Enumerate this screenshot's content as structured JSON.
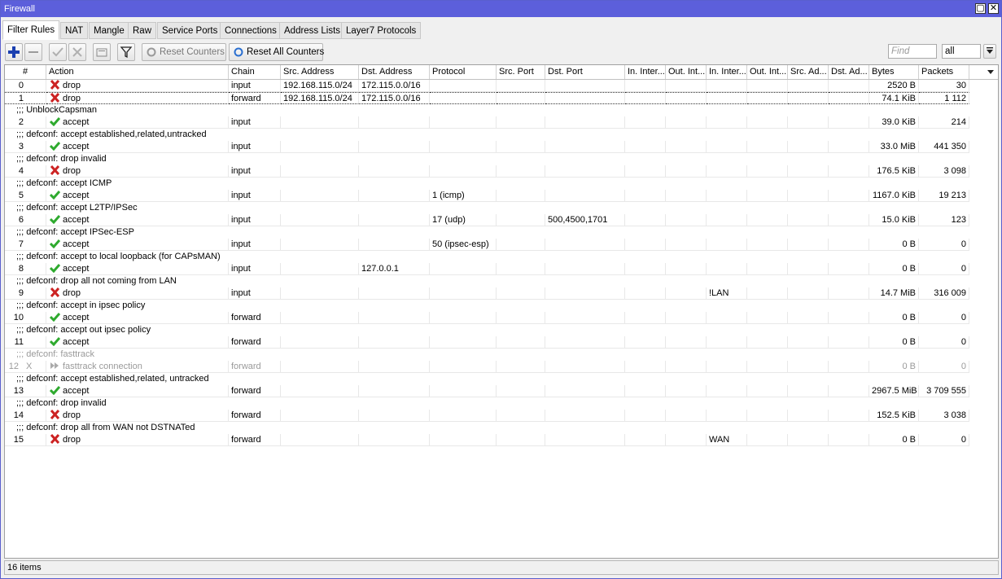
{
  "window": {
    "title": "Firewall"
  },
  "tabs": [
    "Filter Rules",
    "NAT",
    "Mangle",
    "Raw",
    "Service Ports",
    "Connections",
    "Address Lists",
    "Layer7 Protocols"
  ],
  "toolbar": {
    "reset_counters": "Reset Counters",
    "reset_all_counters": "Reset All Counters",
    "find_placeholder": "Find",
    "filter_value": "all"
  },
  "columns": [
    "#",
    "Action",
    "Chain",
    "Src. Address",
    "Dst. Address",
    "Protocol",
    "Src. Port",
    "Dst. Port",
    "In. Inter...",
    "Out. Int...",
    "In. Inter...",
    "Out. Int...",
    "Src. Ad...",
    "Dst. Ad...",
    "Bytes",
    "Packets"
  ],
  "rows": [
    {
      "type": "rule",
      "num": "0",
      "flag": "",
      "action": "drop",
      "icon": "drop",
      "chain": "input",
      "src": "192.168.115.0/24",
      "dst": "172.115.0.0/16",
      "proto": "",
      "sport": "",
      "dport": "",
      "inil": "",
      "bytes": "2520 B",
      "packets": "30"
    },
    {
      "type": "rule",
      "num": "1",
      "flag": "",
      "action": "drop",
      "icon": "drop",
      "chain": "forward",
      "src": "192.168.115.0/24",
      "dst": "172.115.0.0/16",
      "proto": "",
      "sport": "",
      "dport": "",
      "inil": "",
      "bytes": "74.1 KiB",
      "packets": "1 112",
      "selected": true
    },
    {
      "type": "comment",
      "text": ";;; UnblockCapsman"
    },
    {
      "type": "rule",
      "num": "2",
      "flag": "",
      "action": "accept",
      "icon": "accept",
      "chain": "input",
      "src": "",
      "dst": "",
      "proto": "",
      "sport": "",
      "dport": "",
      "inil": "",
      "bytes": "39.0 KiB",
      "packets": "214"
    },
    {
      "type": "comment",
      "text": ";;; defconf: accept established,related,untracked"
    },
    {
      "type": "rule",
      "num": "3",
      "flag": "",
      "action": "accept",
      "icon": "accept",
      "chain": "input",
      "src": "",
      "dst": "",
      "proto": "",
      "sport": "",
      "dport": "",
      "inil": "",
      "bytes": "33.0 MiB",
      "packets": "441 350"
    },
    {
      "type": "comment",
      "text": ";;; defconf: drop invalid"
    },
    {
      "type": "rule",
      "num": "4",
      "flag": "",
      "action": "drop",
      "icon": "drop",
      "chain": "input",
      "src": "",
      "dst": "",
      "proto": "",
      "sport": "",
      "dport": "",
      "inil": "",
      "bytes": "176.5 KiB",
      "packets": "3 098"
    },
    {
      "type": "comment",
      "text": ";;; defconf: accept ICMP"
    },
    {
      "type": "rule",
      "num": "5",
      "flag": "",
      "action": "accept",
      "icon": "accept",
      "chain": "input",
      "src": "",
      "dst": "",
      "proto": "1 (icmp)",
      "sport": "",
      "dport": "",
      "inil": "",
      "bytes": "1167.0 KiB",
      "packets": "19 213"
    },
    {
      "type": "comment",
      "text": ";;; defconf: accept L2TP/IPSec"
    },
    {
      "type": "rule",
      "num": "6",
      "flag": "",
      "action": "accept",
      "icon": "accept",
      "chain": "input",
      "src": "",
      "dst": "",
      "proto": "17 (udp)",
      "sport": "",
      "dport": "500,4500,1701",
      "inil": "",
      "bytes": "15.0 KiB",
      "packets": "123"
    },
    {
      "type": "comment",
      "text": ";;; defconf: accept IPSec-ESP"
    },
    {
      "type": "rule",
      "num": "7",
      "flag": "",
      "action": "accept",
      "icon": "accept",
      "chain": "input",
      "src": "",
      "dst": "",
      "proto": "50 (ipsec-esp)",
      "sport": "",
      "dport": "",
      "inil": "",
      "bytes": "0 B",
      "packets": "0"
    },
    {
      "type": "comment",
      "text": ";;; defconf: accept to local loopback (for CAPsMAN)"
    },
    {
      "type": "rule",
      "num": "8",
      "flag": "",
      "action": "accept",
      "icon": "accept",
      "chain": "input",
      "src": "",
      "dst": "127.0.0.1",
      "proto": "",
      "sport": "",
      "dport": "",
      "inil": "",
      "bytes": "0 B",
      "packets": "0"
    },
    {
      "type": "comment",
      "text": ";;; defconf: drop all not coming from LAN"
    },
    {
      "type": "rule",
      "num": "9",
      "flag": "",
      "action": "drop",
      "icon": "drop",
      "chain": "input",
      "src": "",
      "dst": "",
      "proto": "",
      "sport": "",
      "dport": "",
      "inil": "!LAN",
      "bytes": "14.7 MiB",
      "packets": "316 009"
    },
    {
      "type": "comment",
      "text": ";;; defconf: accept in ipsec policy"
    },
    {
      "type": "rule",
      "num": "10",
      "flag": "",
      "action": "accept",
      "icon": "accept",
      "chain": "forward",
      "src": "",
      "dst": "",
      "proto": "",
      "sport": "",
      "dport": "",
      "inil": "",
      "bytes": "0 B",
      "packets": "0"
    },
    {
      "type": "comment",
      "text": ";;; defconf: accept out ipsec policy"
    },
    {
      "type": "rule",
      "num": "11",
      "flag": "",
      "action": "accept",
      "icon": "accept",
      "chain": "forward",
      "src": "",
      "dst": "",
      "proto": "",
      "sport": "",
      "dport": "",
      "inil": "",
      "bytes": "0 B",
      "packets": "0"
    },
    {
      "type": "comment",
      "text": ";;; defconf: fasttrack",
      "disabled": true
    },
    {
      "type": "rule",
      "num": "12",
      "flag": "X",
      "action": "fasttrack connection",
      "icon": "fasttrack",
      "chain": "forward",
      "src": "",
      "dst": "",
      "proto": "",
      "sport": "",
      "dport": "",
      "inil": "",
      "bytes": "0 B",
      "packets": "0",
      "disabled": true
    },
    {
      "type": "comment",
      "text": ";;; defconf: accept established,related, untracked"
    },
    {
      "type": "rule",
      "num": "13",
      "flag": "",
      "action": "accept",
      "icon": "accept",
      "chain": "forward",
      "src": "",
      "dst": "",
      "proto": "",
      "sport": "",
      "dport": "",
      "inil": "",
      "bytes": "2967.5 MiB",
      "packets": "3 709 555"
    },
    {
      "type": "comment",
      "text": ";;; defconf: drop invalid"
    },
    {
      "type": "rule",
      "num": "14",
      "flag": "",
      "action": "drop",
      "icon": "drop",
      "chain": "forward",
      "src": "",
      "dst": "",
      "proto": "",
      "sport": "",
      "dport": "",
      "inil": "",
      "bytes": "152.5 KiB",
      "packets": "3 038"
    },
    {
      "type": "comment",
      "text": ";;; defconf: drop all from WAN not DSTNATed"
    },
    {
      "type": "rule",
      "num": "15",
      "flag": "",
      "action": "drop",
      "icon": "drop",
      "chain": "forward",
      "src": "",
      "dst": "",
      "proto": "",
      "sport": "",
      "dport": "",
      "inil": "WAN",
      "bytes": "0 B",
      "packets": "0"
    }
  ],
  "status": {
    "items": "16 items"
  },
  "colors": {
    "titlebar": "#5c5fdb",
    "accept": "#2eaa2e",
    "drop": "#cc2222",
    "add": "#1a3fb0"
  }
}
